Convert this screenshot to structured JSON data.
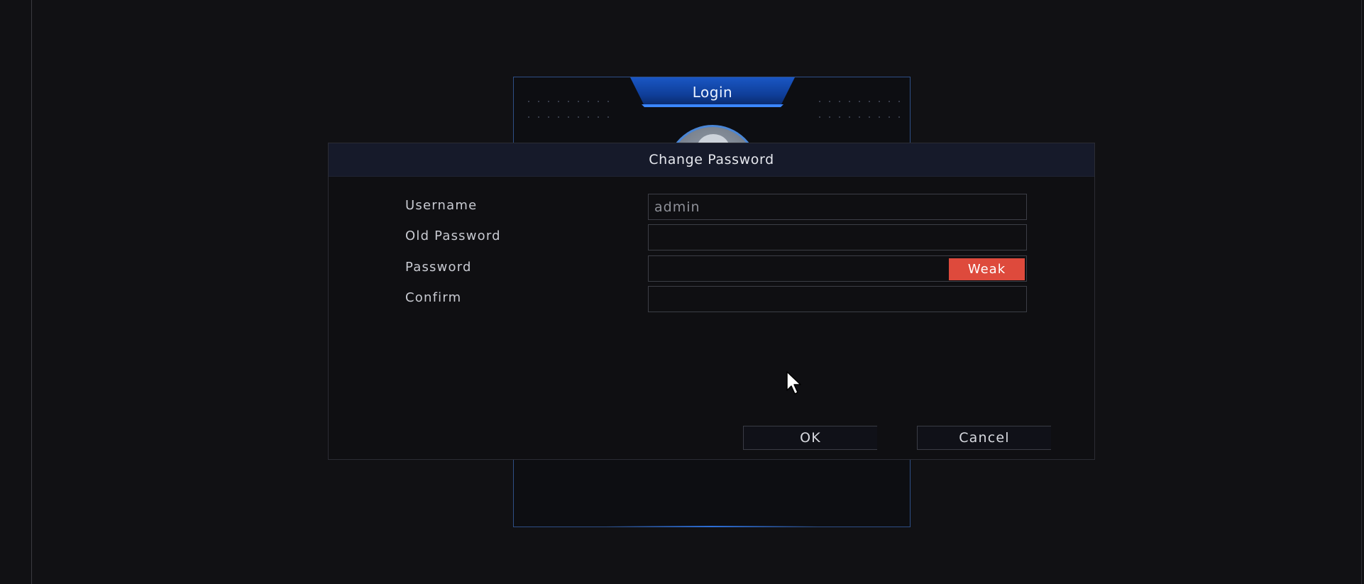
{
  "login_window": {
    "title": "Login"
  },
  "dialog": {
    "title": "Change Password",
    "fields": [
      {
        "label": "Username",
        "value": "admin",
        "placeholder": ""
      },
      {
        "label": "Old Password",
        "value": "",
        "placeholder": ""
      },
      {
        "label": "Password",
        "value": "",
        "placeholder": ""
      },
      {
        "label": "Confirm",
        "value": "",
        "placeholder": ""
      }
    ],
    "strength_label": "Weak",
    "ok_label": "OK",
    "cancel_label": "Cancel"
  },
  "colors": {
    "accent_blue": "#2d6fd8",
    "weak_red": "#de4a3c",
    "background": "#111114",
    "dialog_header": "#161a2a"
  },
  "icons": {
    "cursor": "arrow-cursor-icon",
    "avatar": "user-avatar-icon"
  }
}
